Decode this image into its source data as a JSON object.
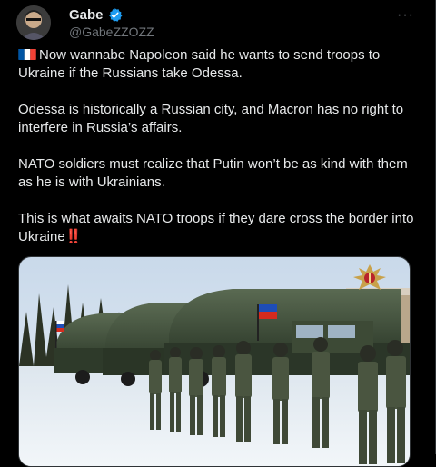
{
  "author": {
    "display_name": "Gabe",
    "handle": "@GabeZZOZZ"
  },
  "tweet": {
    "paragraphs": [
      {
        "text": "Now wannabe Napoleon said he wants to send troops to Ukraine if the Russians take Odessa.",
        "flag": "france"
      },
      {
        "text": "Odessa is historically a Russian city, and Macron has no right to interfere in Russia’s affairs."
      },
      {
        "text": "NATO soldiers must realize that Putin won’t be as kind with them as he is with Ukrainians."
      },
      {
        "text": "This is what awaits NATO troops if they dare cross the border into Ukraine",
        "suffix_emoji": "‼️"
      }
    ]
  },
  "media": {
    "type": "video",
    "description_icons": [
      "russian-mod-emblem-icon"
    ]
  },
  "colors": {
    "background": "#000000",
    "text": "#e7e9ea",
    "muted": "#71767b",
    "verified": "#1d9bf0"
  },
  "icons": {
    "verified": "verified-badge-icon",
    "more": "more-options-icon"
  }
}
